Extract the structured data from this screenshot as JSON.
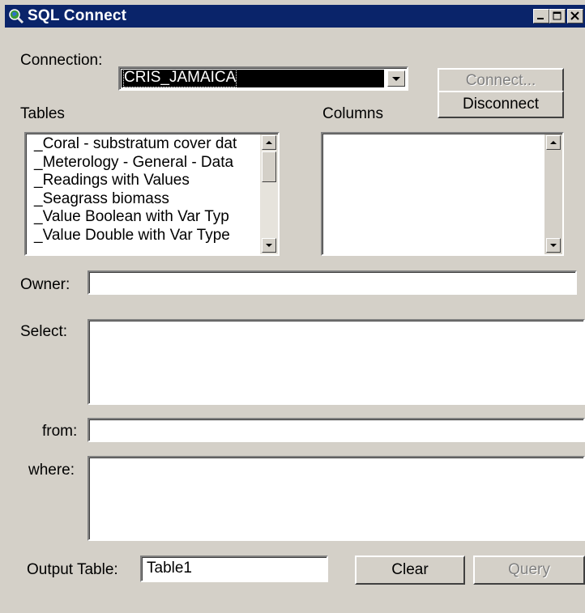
{
  "window": {
    "title": "SQL Connect"
  },
  "connection": {
    "label": "Connection:",
    "value": "CRIS_JAMAICA",
    "connect_label": "Connect...",
    "disconnect_label": "Disconnect"
  },
  "tables": {
    "label": "Tables",
    "items": [
      "_Coral - substratum cover dat",
      "_Meterology - General - Data",
      "_Readings with Values",
      "_Seagrass biomass",
      "_Value Boolean with Var Typ",
      "_Value Double with Var Type"
    ]
  },
  "columns": {
    "label": "Columns"
  },
  "owner": {
    "label": "Owner:",
    "value": ""
  },
  "select": {
    "label": "Select:",
    "value": ""
  },
  "from": {
    "label": "from:",
    "value": ""
  },
  "where": {
    "label": "where:",
    "value": ""
  },
  "output": {
    "label": "Output Table:",
    "value": "Table1"
  },
  "actions": {
    "clear_label": "Clear",
    "query_label": "Query"
  },
  "icons": {
    "app": "sql-magnifier-globe-icon",
    "minimize": "minimize-icon",
    "maximize": "maximize-icon",
    "close": "close-icon"
  }
}
